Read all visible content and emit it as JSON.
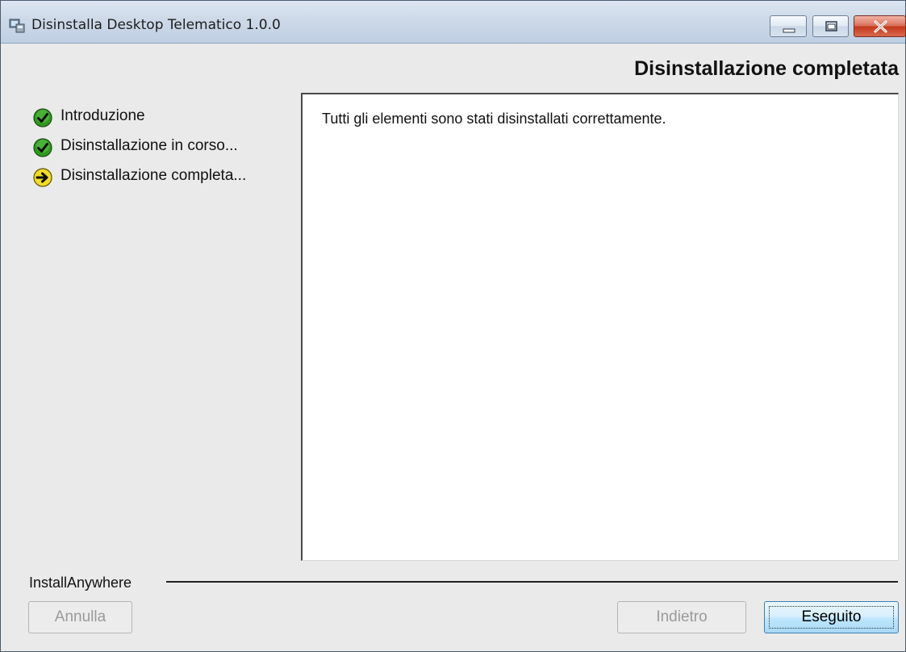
{
  "window": {
    "title": "Disinstalla Desktop Telematico 1.0.0",
    "icon": "installer-app-icon",
    "controls": [
      "minimize-icon",
      "maximize-icon",
      "close-icon"
    ]
  },
  "header": {
    "title": "Disinstallazione completata"
  },
  "steps": [
    {
      "label": "Introduzione",
      "icon": "check-circle-icon",
      "status": "completed"
    },
    {
      "label": "Disinstallazione in corso...",
      "icon": "check-circle-icon",
      "status": "completed"
    },
    {
      "label": "Disinstallazione completa...",
      "icon": "arrow-right-circle-icon",
      "status": "current"
    }
  ],
  "content": {
    "message": "Tutti gli elementi sono stati disinstallati correttamente."
  },
  "footer": {
    "vendor": "InstallAnywhere",
    "cancel_label": "Annulla",
    "back_label": "Indietro",
    "done_label": "Eseguito"
  },
  "colors": {
    "check_green": "#2e9a1e",
    "current_yellow": "#f2dc1e",
    "close_red": "#c5381c",
    "default_button_blue": "#bee6fd"
  }
}
